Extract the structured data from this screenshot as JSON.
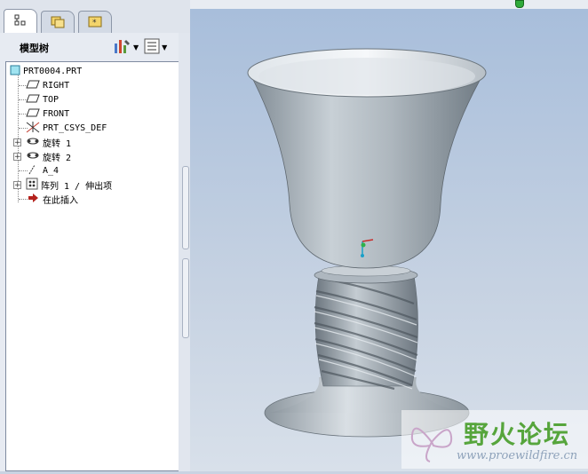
{
  "tabs": [
    {
      "icon": "model-tree-icon",
      "active": true
    },
    {
      "icon": "folder-browser-icon",
      "active": false
    },
    {
      "icon": "favorites-icon",
      "active": false
    }
  ],
  "tree_panel": {
    "title": "模型树",
    "settings_icon": "tree-settings-icon",
    "show_icon": "tree-show-icon"
  },
  "model_tree": {
    "root": "PRT0004.PRT",
    "items": [
      {
        "label": "RIGHT",
        "icon": "datum-plane-icon",
        "expandable": false
      },
      {
        "label": "TOP",
        "icon": "datum-plane-icon",
        "expandable": false
      },
      {
        "label": "FRONT",
        "icon": "datum-plane-icon",
        "expandable": false
      },
      {
        "label": "PRT_CSYS_DEF",
        "icon": "coordinate-system-icon",
        "expandable": false
      },
      {
        "label": "旋转 1",
        "icon": "revolve-icon",
        "expandable": true
      },
      {
        "label": "旋转 2",
        "icon": "revolve-icon",
        "expandable": true
      },
      {
        "label": "A_4",
        "icon": "datum-axis-icon",
        "expandable": false
      },
      {
        "label": "阵列 1 / 伸出项",
        "icon": "pattern-icon",
        "expandable": true
      },
      {
        "label": "在此插入",
        "icon": "insert-here-arrow-icon",
        "expandable": false
      }
    ]
  },
  "viewport": {
    "model": "goblet-3d-model",
    "status_indicator_color": "#2faa3a"
  },
  "watermark": {
    "title": "野火论坛",
    "url": "www.proewildfire.cn"
  }
}
